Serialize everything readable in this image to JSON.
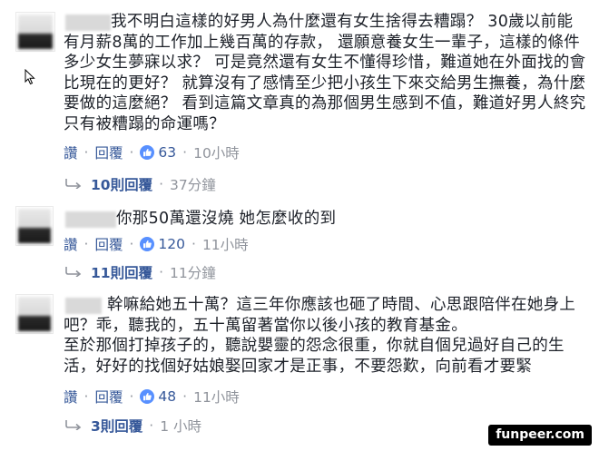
{
  "comments": [
    {
      "lines": [
        "我不明白這樣的好男人為什麼還有女生捨得去糟蹋？ 30歲以前能",
        "有月薪8萬的工作加上幾百萬的存款， 還願意養女生一輩子，這樣的條件",
        "多少女生夢寐以求？ 可是竟然還有女生不懂得珍惜，難道她在外面找的會",
        "比現在的更好？ 就算沒有了感情至少把小孩生下來交給男生撫養，為什麼",
        "要做的這麼絕？ 看到這篇文章真的為那個男生感到不值，難道好男人終究",
        "只有被糟蹋的命運嗎？"
      ],
      "like_label": "讚",
      "reply_label": "回覆",
      "like_count": "63",
      "time": "10小時",
      "replies_label": "10則回覆",
      "replies_time": "37分鐘"
    },
    {
      "lines": [
        "你那50萬還沒燒 她怎麼收的到"
      ],
      "like_label": "讚",
      "reply_label": "回覆",
      "like_count": "120",
      "time": "11小時",
      "replies_label": "11則回覆",
      "replies_time": "11分鐘"
    },
    {
      "lines": [
        "幹嘛給她五十萬？這三年你應該也砸了時間、心思跟陪伴在她身上",
        "吧？乖，聽我的，五十萬留著當你以後小孩的教育基金。",
        "至於那個打掉孩子的，聽說嬰靈的怨念很重，你就自個兒過好自己的生",
        "活，好好的找個好姑娘娶回家才是正事，不要怨歎，向前看才要緊"
      ],
      "like_label": "讚",
      "reply_label": "回覆",
      "like_count": "48",
      "time": "11小時",
      "replies_label": "3則回覆",
      "replies_time": "1 小時"
    }
  ],
  "separator": "·",
  "watermark": "funpeer.com",
  "colors": {
    "link": "#365899",
    "meta": "#90949c",
    "like_badge": "#5890ff",
    "text": "#1d2129"
  },
  "icons": {
    "like": "thumbs-up-icon",
    "reply": "reply-arrow-icon",
    "cursor": "mouse-pointer-icon"
  }
}
